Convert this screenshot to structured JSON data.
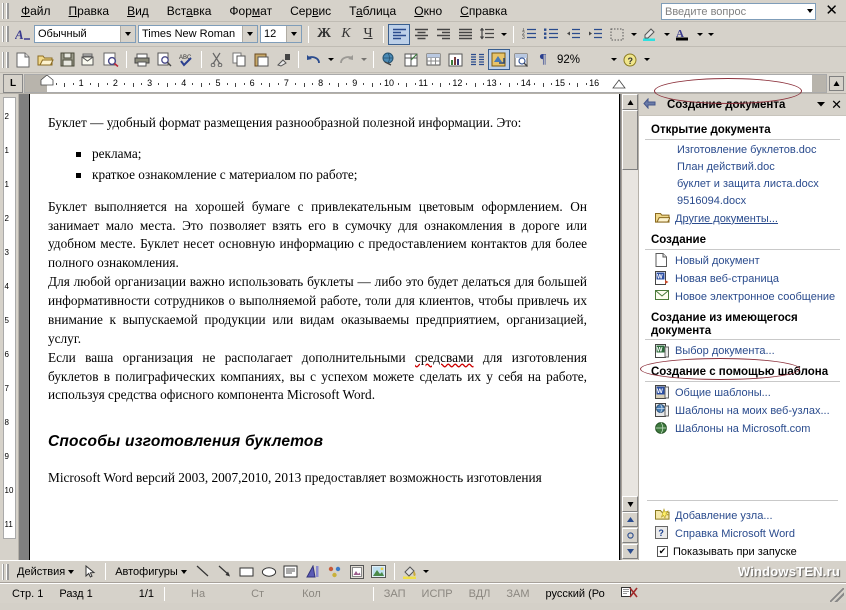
{
  "menubar": {
    "items": [
      "Файл",
      "Правка",
      "Вид",
      "Вставка",
      "Формат",
      "Сервис",
      "Таблица",
      "Окно",
      "Справка"
    ],
    "ask_placeholder": "Введите вопрос",
    "close_label": "✕"
  },
  "formatting_toolbar": {
    "style_value": "Обычный",
    "font_value": "Times New Roman",
    "size_value": "12",
    "bold_label": "Ж",
    "italic_label": "К",
    "underline_label": "Ч",
    "highlight_color": "#2ee0e0",
    "font_color": "#000000"
  },
  "standard_toolbar": {
    "zoom_value": "92%"
  },
  "ruler": {
    "tab_selector": "L",
    "numbers": [
      "1",
      "2",
      "3",
      "4",
      "5",
      "6",
      "7",
      "8",
      "9",
      "10",
      "11",
      "12",
      "13",
      "14",
      "15",
      "16"
    ]
  },
  "vertical_ruler": {
    "numbers": [
      "2",
      "1",
      "1",
      "2",
      "3",
      "4",
      "5",
      "6",
      "7",
      "8",
      "9",
      "10",
      "11"
    ]
  },
  "document": {
    "intro": "Буклет — удобный формат размещения разнообразной полезной информации. Это:",
    "bullets": [
      "реклама;",
      "краткое ознакомление с материалом по работе;"
    ],
    "para2": "Буклет выполняется на хорошей бумаге с привлекательным цветовым оформлением. Он занимает мало места. Это позволяет взять его в сумочку для ознакомления в дороге или удобном месте. Буклет несет основную информацию с предоставлением контактов для более полного ознакомления.",
    "para3": "Для любой организации важно использовать буклеты — либо это будет делаться для большей информативности сотрудников о выполняемой работе, толи для клиентов, чтобы привлечь их внимание к выпускаемой продукции или видам оказываемы предприятием, организацией, услуг.",
    "para4_a": "Если ваша организация не располагает дополнительными ",
    "para4_squiggle": "средсвами",
    "para4_b": " для изготовления буклетов в полиграфических компаниях, вы с успехом можете сделать их у себя на работе, используя средства офисного компонента Microsoft Word.",
    "heading2": "Способы изготовления буклетов",
    "para5": "Microsoft Word версий 2003, 2007,2010, 2013 предоставляет возможность изготовления"
  },
  "task_pane": {
    "title": "Создание документа",
    "back_icon": "back-arrow-icon",
    "menu_icon": "chevron-down-icon",
    "close_icon": "close-icon",
    "sections": [
      {
        "heading": "Открытие документа",
        "links": [
          "Изготовление буклетов.doc",
          "План действий.doc",
          "буклет и защита листа.docx",
          "9516094.docx"
        ],
        "items": [
          {
            "icon": "open-folder-icon",
            "label": "Другие документы...",
            "underline": true
          }
        ]
      },
      {
        "heading": "Создание",
        "links": [],
        "items": [
          {
            "icon": "blank-document-icon",
            "label": "Новый документ",
            "underline": false
          },
          {
            "icon": "web-page-icon",
            "label": "Новая веб-страница",
            "underline": false
          },
          {
            "icon": "email-icon",
            "label": "Новое электронное сообщение",
            "underline": false
          }
        ]
      },
      {
        "heading": "Создание из имеющегося документа",
        "links": [],
        "items": [
          {
            "icon": "choose-document-icon",
            "label": "Выбор документа...",
            "underline": false
          }
        ]
      },
      {
        "heading": "Создание с помощью шаблона",
        "links": [],
        "items": [
          {
            "icon": "general-templates-icon",
            "label": "Общие шаблоны...",
            "underline": false
          },
          {
            "icon": "web-templates-icon",
            "label": "Шаблоны на моих веб-узлах...",
            "underline": false
          },
          {
            "icon": "microsoft-templates-icon",
            "label": "Шаблоны на Microsoft.com",
            "underline": false
          }
        ]
      }
    ],
    "footer_items": [
      {
        "icon": "add-node-icon",
        "label": "Добавление узла..."
      },
      {
        "icon": "help-icon",
        "label": "Справка Microsoft Word"
      }
    ],
    "startup_checkbox": {
      "label": "Показывать при запуске",
      "checked": true
    }
  },
  "annotations": {
    "ellipse_color": "#8b2f3a",
    "targets": [
      "Создание документа",
      "Общие шаблоны..."
    ]
  },
  "drawing_toolbar": {
    "actions_label": "Действия",
    "autoshapes_label": "Автофигуры",
    "icons": [
      "select-arrow-icon",
      "line-icon",
      "arrow-icon",
      "rectangle-icon",
      "oval-icon",
      "text-box-icon",
      "wordart-icon",
      "diagram-icon",
      "clipart-icon",
      "picture-icon",
      "fill-color-icon"
    ]
  },
  "statusbar": {
    "page_label": "Стр.",
    "page_value": "1",
    "section_label": "Разд",
    "section_value": "1",
    "page_of": "1/1",
    "at_label": "На",
    "line_label": "Ст",
    "col_label": "Кол",
    "rec": "ЗАП",
    "trk": "ИСПР",
    "ext": "ВДЛ",
    "ovr": "ЗАМ",
    "language": "русский (Ро",
    "spell_icon": "spelling-status-icon"
  },
  "watermark": {
    "text": "WindowsTEN.ru"
  }
}
